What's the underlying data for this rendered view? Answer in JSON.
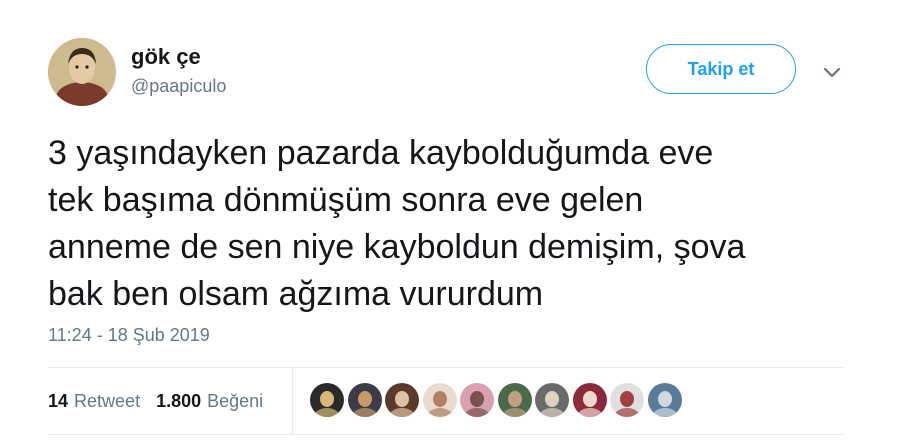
{
  "user": {
    "display_name": "gök çe",
    "handle": "@paapiculo",
    "avatar_icon": "portrait-avatar"
  },
  "follow_button": {
    "label": "Takip et"
  },
  "menu": {
    "icon": "chevron-down-icon"
  },
  "tweet": {
    "text": "3 yaşındayken pazarda kaybolduğumda eve\ntek başıma dönmüşüm sonra eve gelen\nanneme de sen niye kayboldun demişim, şova\nbak ben olsam ağzıma vururdum",
    "timestamp": "11:24 - 18 Şub 2019"
  },
  "stats": {
    "retweets": {
      "count": "14",
      "label": "Retweet"
    },
    "likes": {
      "count": "1.800",
      "label": "Beğeni"
    }
  },
  "likers": [
    {
      "colors": [
        "#2a2a2a",
        "#d9b77a"
      ]
    },
    {
      "colors": [
        "#3b3b4a",
        "#c89a6a"
      ]
    },
    {
      "colors": [
        "#5a3a2a",
        "#e0c0a0"
      ]
    },
    {
      "colors": [
        "#e8dcd0",
        "#b08060"
      ]
    },
    {
      "colors": [
        "#d9a0b0",
        "#7a5050"
      ]
    },
    {
      "colors": [
        "#4a6a4a",
        "#c0a080"
      ]
    },
    {
      "colors": [
        "#6a6a6a",
        "#e0d0c0"
      ]
    },
    {
      "colors": [
        "#8a2a3a",
        "#f0d8d0"
      ]
    },
    {
      "colors": [
        "#e0e0e0",
        "#a04040"
      ]
    },
    {
      "colors": [
        "#5a7a9a",
        "#d0d8e0"
      ]
    }
  ],
  "colors": {
    "accent": "#1da1f2",
    "text_primary": "#14171a",
    "text_secondary": "#657786",
    "divider": "#e6ecf0"
  }
}
